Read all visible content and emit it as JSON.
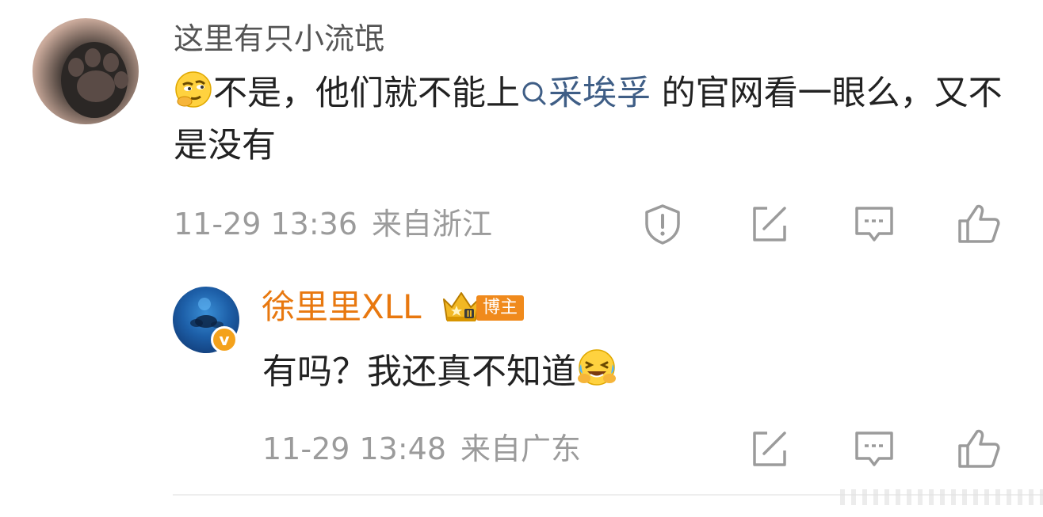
{
  "comment": {
    "username": "这里有只小流氓",
    "emoji": "thinking-face-emoji",
    "text_before_link": "不是，他们就不能上",
    "link_text": "采埃孚",
    "text_after_link": " 的官网看一眼么，又不是没有",
    "time": "11-29 13:36",
    "location": "来自浙江",
    "actions": [
      "report-icon",
      "share-icon",
      "comment-icon",
      "like-icon"
    ]
  },
  "reply": {
    "username": "徐里里XLL",
    "badge": "博主",
    "text": "有吗？我还真不知道",
    "emoji": "laugh-cry-emoji",
    "time": "11-29 13:48",
    "location": "来自广东",
    "actions": [
      "share-icon",
      "comment-icon",
      "like-icon"
    ]
  },
  "colors": {
    "link": "#3f5e86",
    "meta_text": "#9b9b9b",
    "username_verified": "#e8780f",
    "badge_bg": "#f08a1c"
  }
}
